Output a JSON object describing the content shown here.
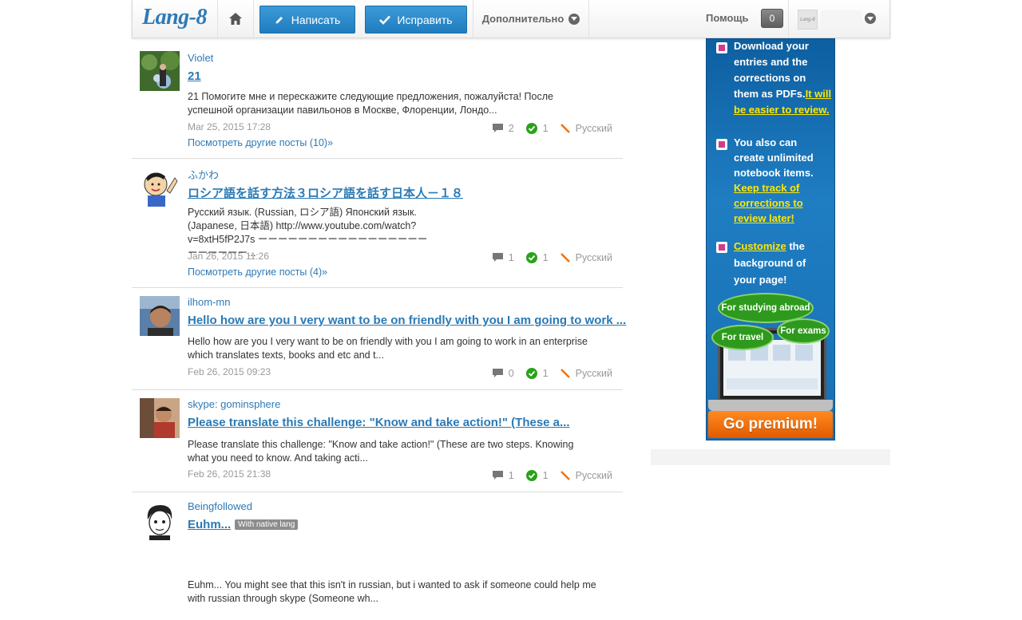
{
  "header": {
    "logo": "Lang-8",
    "write_label": "Написать",
    "correct_label": "Исправить",
    "more_label": "Дополнительно",
    "help_label": "Помощь",
    "notifications_count": "0",
    "user_avatar_text": "Lang-8"
  },
  "posts": [
    {
      "author": "Violet",
      "title": "21",
      "excerpt": "21 Помогите мне и перескажите следующие предложения, пожалуйста! После успешной организации павильонов в Москве, Флоренции, Лондо...",
      "date": "Mar 25, 2015 17:28",
      "comments": "2",
      "corrections": "1",
      "language": "Русский",
      "more_posts": "Посмотреть другие посты (10)»"
    },
    {
      "author": "ふかわ",
      "title": "ロシア語を話す方法３ロシア語を話す日本人－１８",
      "excerpt": "Русский язык. (Russian, ロシア語) Японский язык. (Japanese, 日本語) http://www.youtube.com/watch?v=8xtH5fP2J7s ーーーーーーーーーーーーーーーーーーーーーーー...",
      "date": "Jan 26, 2015 11:26",
      "comments": "1",
      "corrections": "1",
      "language": "Русский",
      "more_posts": "Посмотреть другие посты (4)»"
    },
    {
      "author": "ilhom-mn",
      "title": "Hello how are you I very want to be on friendly with you I am going to work ...",
      "excerpt": "Hello how are you I very want to be on friendly with you I am going to work in an enterprise which translates texts, books and etc and t...",
      "date": "Feb 26, 2015 09:23",
      "comments": "0",
      "corrections": "1",
      "language": "Русский"
    },
    {
      "author": "skype: gominsphere",
      "title": "Please translate this challenge: \"Know and take action!\" (These a...",
      "excerpt": "Please translate this challenge: \"Know and take action!\" (These are two steps. Knowing what you need to know. And taking acti...",
      "date": "Feb 26, 2015 21:38",
      "comments": "1",
      "corrections": "1",
      "language": "Русский"
    },
    {
      "author": "Beingfollowed",
      "title": "Euhm...",
      "tag": "With native lang",
      "excerpt": "Euhm... You might see that this isn't in russian, but i wanted to ask if someone could help me with russian through skype (Someone wh..."
    }
  ],
  "ad": {
    "item1_a": "Download your entries and the corrections on them as PDFs.",
    "item1_b": "It will be easier to review.",
    "item2_a": "You also can create unlimited notebook items.",
    "item2_b": "Keep track of corrections to review later!",
    "item3_a": "Customize",
    "item3_b": " the background of your page!",
    "bubble_abroad": "For studying abroad",
    "bubble_travel": "For travel",
    "bubble_exams": "For exams",
    "cta": "Go premium!"
  },
  "colors": {
    "brand_blue": "#2d7ab7",
    "button_blue": "#2585c8",
    "premium_orange": "#f07412",
    "correct_green": "#2aa21a"
  }
}
